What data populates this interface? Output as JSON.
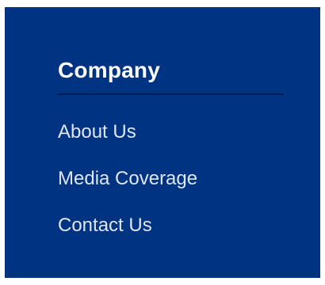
{
  "footer_column": {
    "heading": "Company",
    "links": [
      {
        "label": "About Us"
      },
      {
        "label": "Media Coverage"
      },
      {
        "label": "Contact Us"
      }
    ]
  },
  "colors": {
    "panel_background": "#013383",
    "heading_text": "#ffffff",
    "link_text": "#dfe6f4",
    "divider": "#001c4c"
  }
}
